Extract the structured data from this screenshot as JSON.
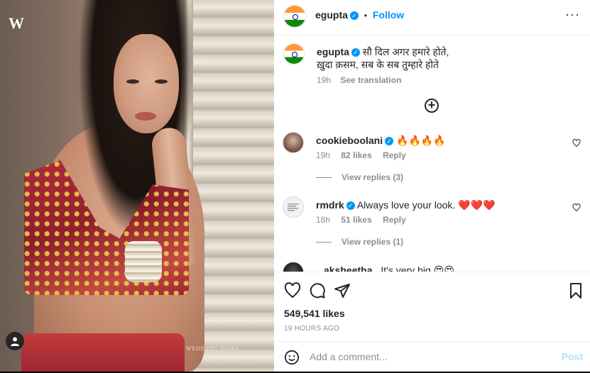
{
  "media": {
    "watermark": "WEDDING VOWS",
    "logo": "W"
  },
  "header": {
    "username": "egupta",
    "dot": "•",
    "follow_label": "Follow",
    "more": "···"
  },
  "caption": {
    "username": "egupta",
    "line1": "सौ दिल अगर हमारे होते,",
    "line2": "ख़ुदा क़सम, सब के सब तुम्हारे होते",
    "time": "19h",
    "translation_label": "See translation"
  },
  "comments": [
    {
      "username": "cookieboolani",
      "text": "🔥🔥🔥🔥",
      "time": "19h",
      "likes": "82 likes",
      "reply_label": "Reply",
      "view_replies": "View replies (3)"
    },
    {
      "username": "rmdrk",
      "text": "Always love your look. ❤️❤️❤️",
      "time": "18h",
      "likes": "51 likes",
      "reply_label": "Reply",
      "view_replies": "View replies (1)"
    },
    {
      "username": "aksheetha",
      "text": "It's very big 😍😍"
    }
  ],
  "actions": {
    "likes_count": "549,541 likes",
    "time_ago": "19 HOURS AGO"
  },
  "add_comment": {
    "placeholder": "Add a comment...",
    "post_label": "Post"
  },
  "colors": {
    "accent": "#0095f6",
    "post_disabled": "#b2dffc",
    "muted": "#8e8e8e"
  }
}
